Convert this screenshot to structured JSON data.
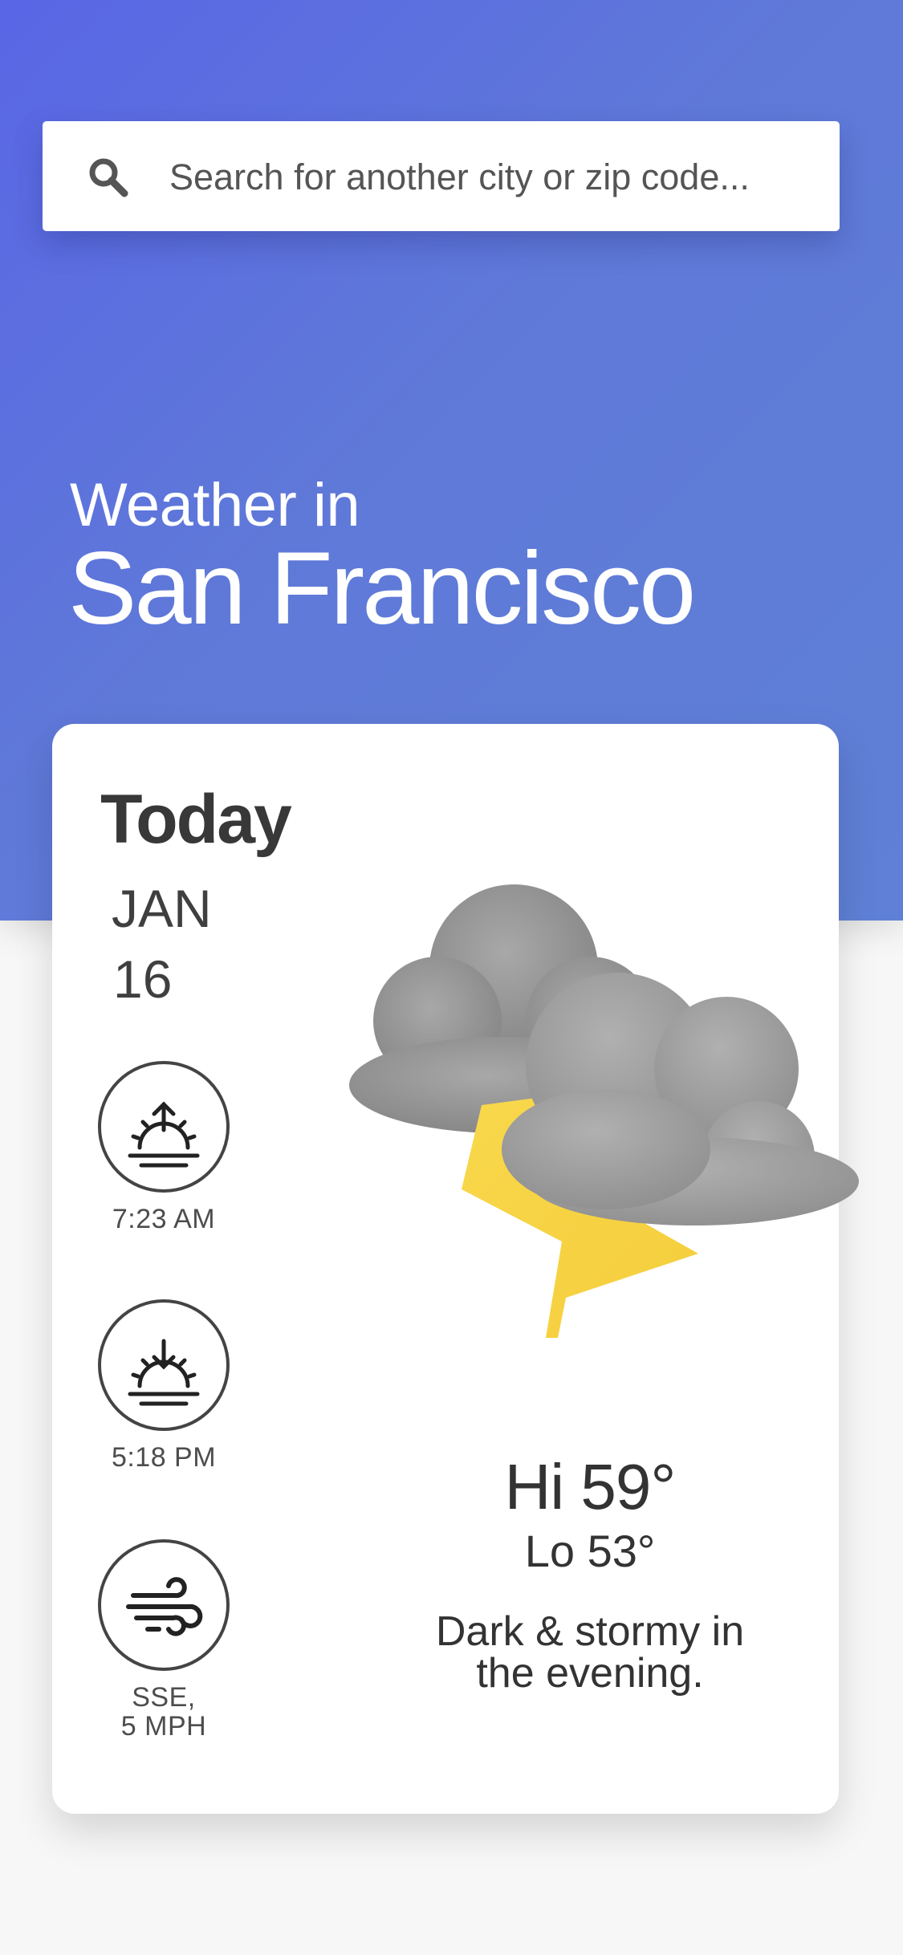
{
  "search": {
    "placeholder": "Search for another city or zip code...",
    "icon": "search-icon"
  },
  "header": {
    "subtitle": "Weather  in",
    "city": "San Francisco"
  },
  "today": {
    "heading": "Today",
    "month": "JAN",
    "day": "16",
    "sunrise": {
      "icon": "sunrise-icon",
      "time": "7:23 AM"
    },
    "sunset": {
      "icon": "sunset-icon",
      "time": "5:18 PM"
    },
    "wind": {
      "icon": "wind-icon",
      "direction": "SSE,",
      "speed": "5 MPH"
    },
    "condition_icon": "thunderstorm-icon",
    "hi": "Hi 59°",
    "lo": "Lo 53°",
    "summary_line1": "Dark & stormy in",
    "summary_line2": "the evening."
  },
  "colors": {
    "hero_start": "#5966e6",
    "hero_end": "#5f80d6",
    "cloud": "#9e9e9e",
    "lightning": "#f7d54a",
    "text": "#383838"
  }
}
